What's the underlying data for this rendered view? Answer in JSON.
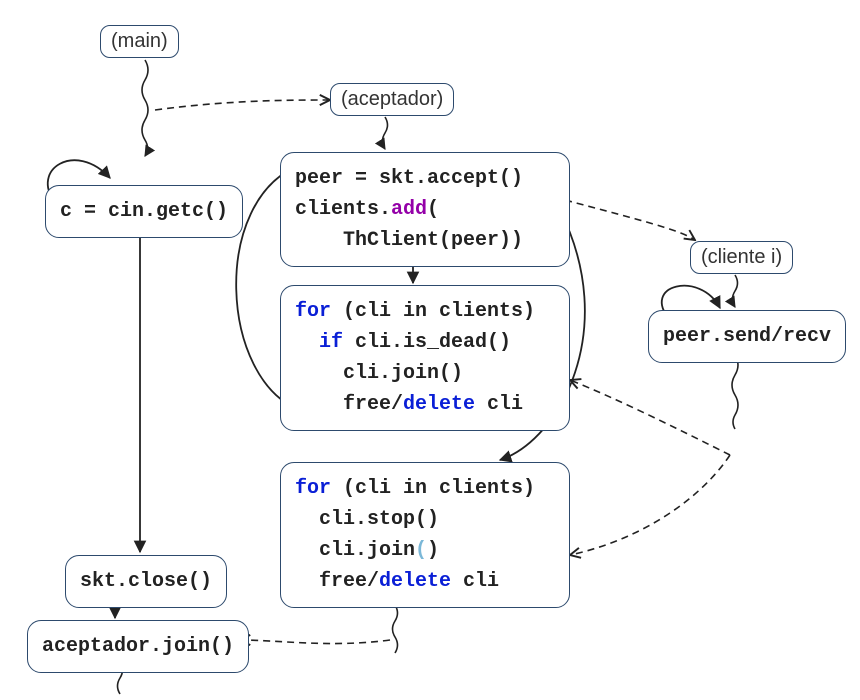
{
  "labels": {
    "main": "(main)",
    "aceptador": "(aceptador)",
    "cliente": "(cliente i)"
  },
  "code": {
    "getc": "c = cin.getc()",
    "accept_l1_a": "peer = skt.accept()",
    "accept_l2_a": "clients.",
    "accept_l2_method": "add",
    "accept_l2_b": "(",
    "accept_l3": "    ThClient(peer))",
    "loop1_l1_a": "for",
    "loop1_l1_b": " (cli in clients)",
    "loop1_l2_a": "  if",
    "loop1_l2_b": " cli.is_dead()",
    "loop1_l3": "    cli.join()",
    "loop1_l4_a": "    free/",
    "loop1_l4_del": "delete",
    "loop1_l4_b": " cli",
    "send_recv": "peer.send/recv",
    "skt_close": "skt.close()",
    "acc_join": "aceptador.join()",
    "loop2_l1_a": "for",
    "loop2_l1_b": " (cli in clients)",
    "loop2_l2": "  cli.stop()",
    "loop2_l3_a": "  cli.join",
    "loop2_l3_p": "(",
    "loop2_l3_b": ")",
    "loop2_l4_a": "  free/",
    "loop2_l4_del": "delete",
    "loop2_l4_b": " cli"
  },
  "colors": {
    "border": "#2d4a6d",
    "keyword": "#0a1fd6",
    "method": "#9400a8",
    "delete": "#0a1fd6"
  }
}
